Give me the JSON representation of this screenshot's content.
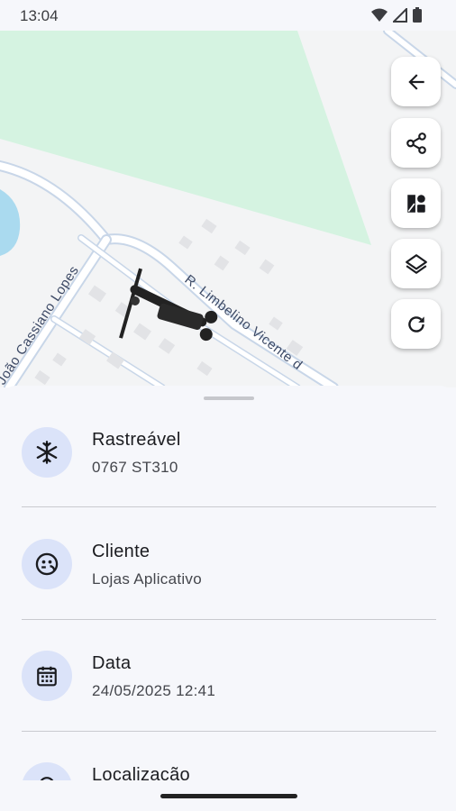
{
  "status": {
    "time": "13:04"
  },
  "map": {
    "streets": [
      "João Cassiano Lopes",
      "R. Limbelino Vicente d"
    ],
    "park_color": "#d5f3e1",
    "water_color": "#aadaef",
    "road_color": "#ffffff",
    "road_border": "#c8d6e8"
  },
  "fabs": [
    "arrow-back-icon",
    "share-icon",
    "map-style-icon",
    "layers-icon",
    "refresh-icon"
  ],
  "details": [
    {
      "title": "Rastreável",
      "value": "0767 ST310",
      "icon": "snowflake-icon"
    },
    {
      "title": "Cliente",
      "value": "Lojas Aplicativo",
      "icon": "client-face-icon"
    },
    {
      "title": "Data",
      "value": "24/05/2025 12:41",
      "icon": "calendar-icon"
    },
    {
      "title": "Localização",
      "value": "",
      "icon": "location-icon"
    }
  ],
  "colors": {
    "accent_bg": "#dbe3f9",
    "icon_dark": "#1b1c20"
  }
}
